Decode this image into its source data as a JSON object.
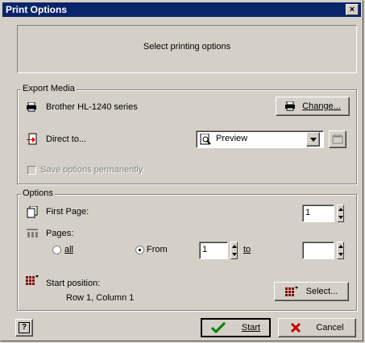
{
  "window": {
    "title": "Print Options",
    "close_glyph": "×"
  },
  "header": {
    "message": "Select printing options"
  },
  "export_media": {
    "group_label": "Export Media",
    "printer_name": "Brother HL-1240 series",
    "change_label": "Change...",
    "direct_to_label": "Direct to...",
    "direct_to_value": "Preview",
    "save_options_label": "Save options permanently"
  },
  "options": {
    "group_label": "Options",
    "first_page_label": "First Page:",
    "first_page_value": "1",
    "pages_label": "Pages:",
    "all_label": "all",
    "from_label": "From",
    "from_value": "1",
    "to_label": "to",
    "to_value": "",
    "start_position_label": "Start position:",
    "start_position_value": "Row 1, Column 1",
    "select_label": "Select..."
  },
  "footer": {
    "help_glyph": "?",
    "start_label": "Start",
    "cancel_label": "Cancel"
  }
}
